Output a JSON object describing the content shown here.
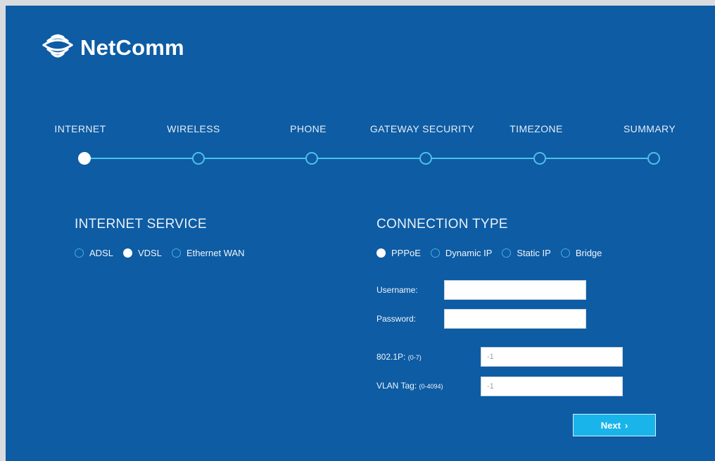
{
  "brand": {
    "name": "NetComm"
  },
  "wizard": {
    "steps": [
      {
        "label": "INTERNET",
        "active": true
      },
      {
        "label": "WIRELESS",
        "active": false
      },
      {
        "label": "PHONE",
        "active": false
      },
      {
        "label": "GATEWAY SECURITY",
        "active": false
      },
      {
        "label": "TIMEZONE",
        "active": false
      },
      {
        "label": "SUMMARY",
        "active": false
      }
    ]
  },
  "internet_service": {
    "title": "INTERNET SERVICE",
    "options": [
      {
        "label": "ADSL",
        "checked": false
      },
      {
        "label": "VDSL",
        "checked": true
      },
      {
        "label": "Ethernet WAN",
        "checked": false
      }
    ]
  },
  "connection_type": {
    "title": "CONNECTION TYPE",
    "options": [
      {
        "label": "PPPoE",
        "checked": true
      },
      {
        "label": "Dynamic IP",
        "checked": false
      },
      {
        "label": "Static IP",
        "checked": false
      },
      {
        "label": "Bridge",
        "checked": false
      }
    ]
  },
  "form": {
    "username_label": "Username:",
    "username_value": "",
    "password_label": "Password:",
    "password_value": "",
    "p8021_label": "802.1P:",
    "p8021_range": "(0-7)",
    "p8021_value": "-1",
    "vlan_label": "VLAN Tag:",
    "vlan_range": "(0-4094)",
    "vlan_value": "-1"
  },
  "actions": {
    "next_label": "Next"
  },
  "colors": {
    "background": "#0d5ca4",
    "accent": "#4ec0e8",
    "button": "#19b4ea"
  }
}
